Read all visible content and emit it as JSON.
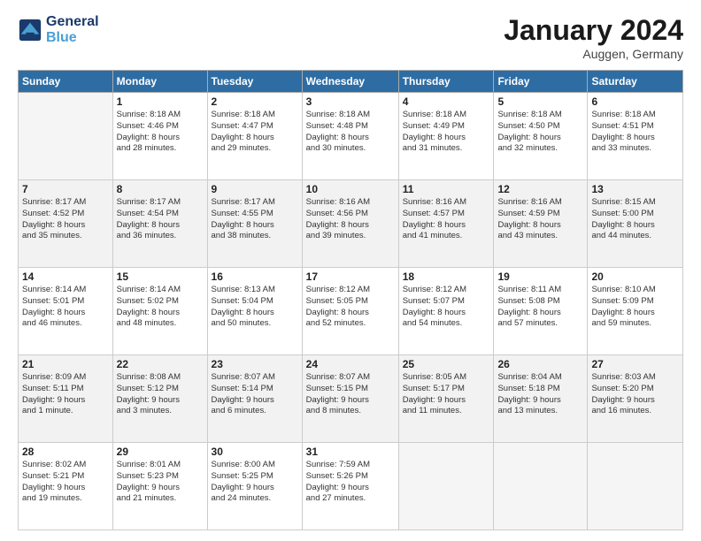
{
  "header": {
    "logo_line1": "General",
    "logo_line2": "Blue",
    "month": "January 2024",
    "location": "Auggen, Germany"
  },
  "weekdays": [
    "Sunday",
    "Monday",
    "Tuesday",
    "Wednesday",
    "Thursday",
    "Friday",
    "Saturday"
  ],
  "weeks": [
    [
      {
        "day": "",
        "info": ""
      },
      {
        "day": "1",
        "info": "Sunrise: 8:18 AM\nSunset: 4:46 PM\nDaylight: 8 hours\nand 28 minutes."
      },
      {
        "day": "2",
        "info": "Sunrise: 8:18 AM\nSunset: 4:47 PM\nDaylight: 8 hours\nand 29 minutes."
      },
      {
        "day": "3",
        "info": "Sunrise: 8:18 AM\nSunset: 4:48 PM\nDaylight: 8 hours\nand 30 minutes."
      },
      {
        "day": "4",
        "info": "Sunrise: 8:18 AM\nSunset: 4:49 PM\nDaylight: 8 hours\nand 31 minutes."
      },
      {
        "day": "5",
        "info": "Sunrise: 8:18 AM\nSunset: 4:50 PM\nDaylight: 8 hours\nand 32 minutes."
      },
      {
        "day": "6",
        "info": "Sunrise: 8:18 AM\nSunset: 4:51 PM\nDaylight: 8 hours\nand 33 minutes."
      }
    ],
    [
      {
        "day": "7",
        "info": "Sunrise: 8:17 AM\nSunset: 4:52 PM\nDaylight: 8 hours\nand 35 minutes."
      },
      {
        "day": "8",
        "info": "Sunrise: 8:17 AM\nSunset: 4:54 PM\nDaylight: 8 hours\nand 36 minutes."
      },
      {
        "day": "9",
        "info": "Sunrise: 8:17 AM\nSunset: 4:55 PM\nDaylight: 8 hours\nand 38 minutes."
      },
      {
        "day": "10",
        "info": "Sunrise: 8:16 AM\nSunset: 4:56 PM\nDaylight: 8 hours\nand 39 minutes."
      },
      {
        "day": "11",
        "info": "Sunrise: 8:16 AM\nSunset: 4:57 PM\nDaylight: 8 hours\nand 41 minutes."
      },
      {
        "day": "12",
        "info": "Sunrise: 8:16 AM\nSunset: 4:59 PM\nDaylight: 8 hours\nand 43 minutes."
      },
      {
        "day": "13",
        "info": "Sunrise: 8:15 AM\nSunset: 5:00 PM\nDaylight: 8 hours\nand 44 minutes."
      }
    ],
    [
      {
        "day": "14",
        "info": "Sunrise: 8:14 AM\nSunset: 5:01 PM\nDaylight: 8 hours\nand 46 minutes."
      },
      {
        "day": "15",
        "info": "Sunrise: 8:14 AM\nSunset: 5:02 PM\nDaylight: 8 hours\nand 48 minutes."
      },
      {
        "day": "16",
        "info": "Sunrise: 8:13 AM\nSunset: 5:04 PM\nDaylight: 8 hours\nand 50 minutes."
      },
      {
        "day": "17",
        "info": "Sunrise: 8:12 AM\nSunset: 5:05 PM\nDaylight: 8 hours\nand 52 minutes."
      },
      {
        "day": "18",
        "info": "Sunrise: 8:12 AM\nSunset: 5:07 PM\nDaylight: 8 hours\nand 54 minutes."
      },
      {
        "day": "19",
        "info": "Sunrise: 8:11 AM\nSunset: 5:08 PM\nDaylight: 8 hours\nand 57 minutes."
      },
      {
        "day": "20",
        "info": "Sunrise: 8:10 AM\nSunset: 5:09 PM\nDaylight: 8 hours\nand 59 minutes."
      }
    ],
    [
      {
        "day": "21",
        "info": "Sunrise: 8:09 AM\nSunset: 5:11 PM\nDaylight: 9 hours\nand 1 minute."
      },
      {
        "day": "22",
        "info": "Sunrise: 8:08 AM\nSunset: 5:12 PM\nDaylight: 9 hours\nand 3 minutes."
      },
      {
        "day": "23",
        "info": "Sunrise: 8:07 AM\nSunset: 5:14 PM\nDaylight: 9 hours\nand 6 minutes."
      },
      {
        "day": "24",
        "info": "Sunrise: 8:07 AM\nSunset: 5:15 PM\nDaylight: 9 hours\nand 8 minutes."
      },
      {
        "day": "25",
        "info": "Sunrise: 8:05 AM\nSunset: 5:17 PM\nDaylight: 9 hours\nand 11 minutes."
      },
      {
        "day": "26",
        "info": "Sunrise: 8:04 AM\nSunset: 5:18 PM\nDaylight: 9 hours\nand 13 minutes."
      },
      {
        "day": "27",
        "info": "Sunrise: 8:03 AM\nSunset: 5:20 PM\nDaylight: 9 hours\nand 16 minutes."
      }
    ],
    [
      {
        "day": "28",
        "info": "Sunrise: 8:02 AM\nSunset: 5:21 PM\nDaylight: 9 hours\nand 19 minutes."
      },
      {
        "day": "29",
        "info": "Sunrise: 8:01 AM\nSunset: 5:23 PM\nDaylight: 9 hours\nand 21 minutes."
      },
      {
        "day": "30",
        "info": "Sunrise: 8:00 AM\nSunset: 5:25 PM\nDaylight: 9 hours\nand 24 minutes."
      },
      {
        "day": "31",
        "info": "Sunrise: 7:59 AM\nSunset: 5:26 PM\nDaylight: 9 hours\nand 27 minutes."
      },
      {
        "day": "",
        "info": ""
      },
      {
        "day": "",
        "info": ""
      },
      {
        "day": "",
        "info": ""
      }
    ]
  ]
}
